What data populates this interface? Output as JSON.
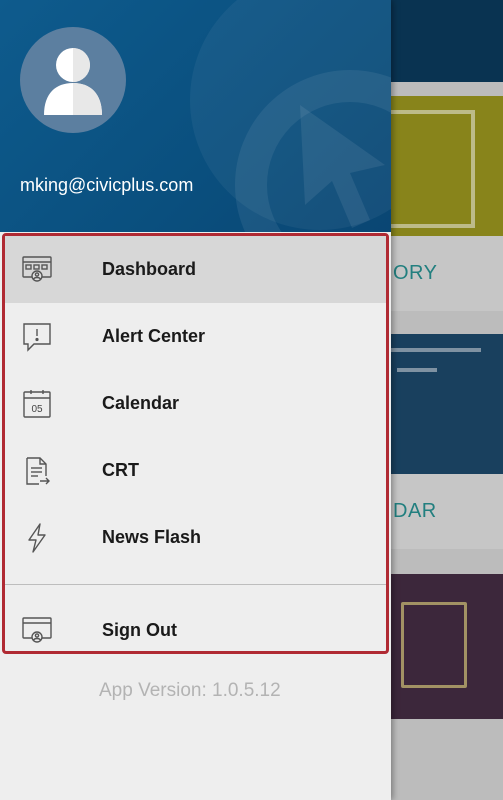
{
  "user": {
    "email": "mking@civicplus.com"
  },
  "menu": {
    "items": [
      {
        "label": "Dashboard",
        "icon": "dashboard-icon",
        "active": true
      },
      {
        "label": "Alert Center",
        "icon": "alert-icon",
        "active": false
      },
      {
        "label": "Calendar",
        "icon": "calendar-icon",
        "active": false
      },
      {
        "label": "CRT",
        "icon": "document-icon",
        "active": false
      },
      {
        "label": "News Flash",
        "icon": "lightning-icon",
        "active": false
      }
    ],
    "sign_out": {
      "label": "Sign Out",
      "icon": "sign-out-icon"
    }
  },
  "calendar_icon_day": "05",
  "version_text": "App Version: 1.0.5.12",
  "background_tiles": [
    {
      "label": "ORY"
    },
    {
      "label": "DAR"
    }
  ],
  "colors": {
    "header": "#0e5b8d",
    "highlight_border": "#b02a33",
    "active_row": "#d7d7d7",
    "tile_text": "#2a9c9c"
  }
}
